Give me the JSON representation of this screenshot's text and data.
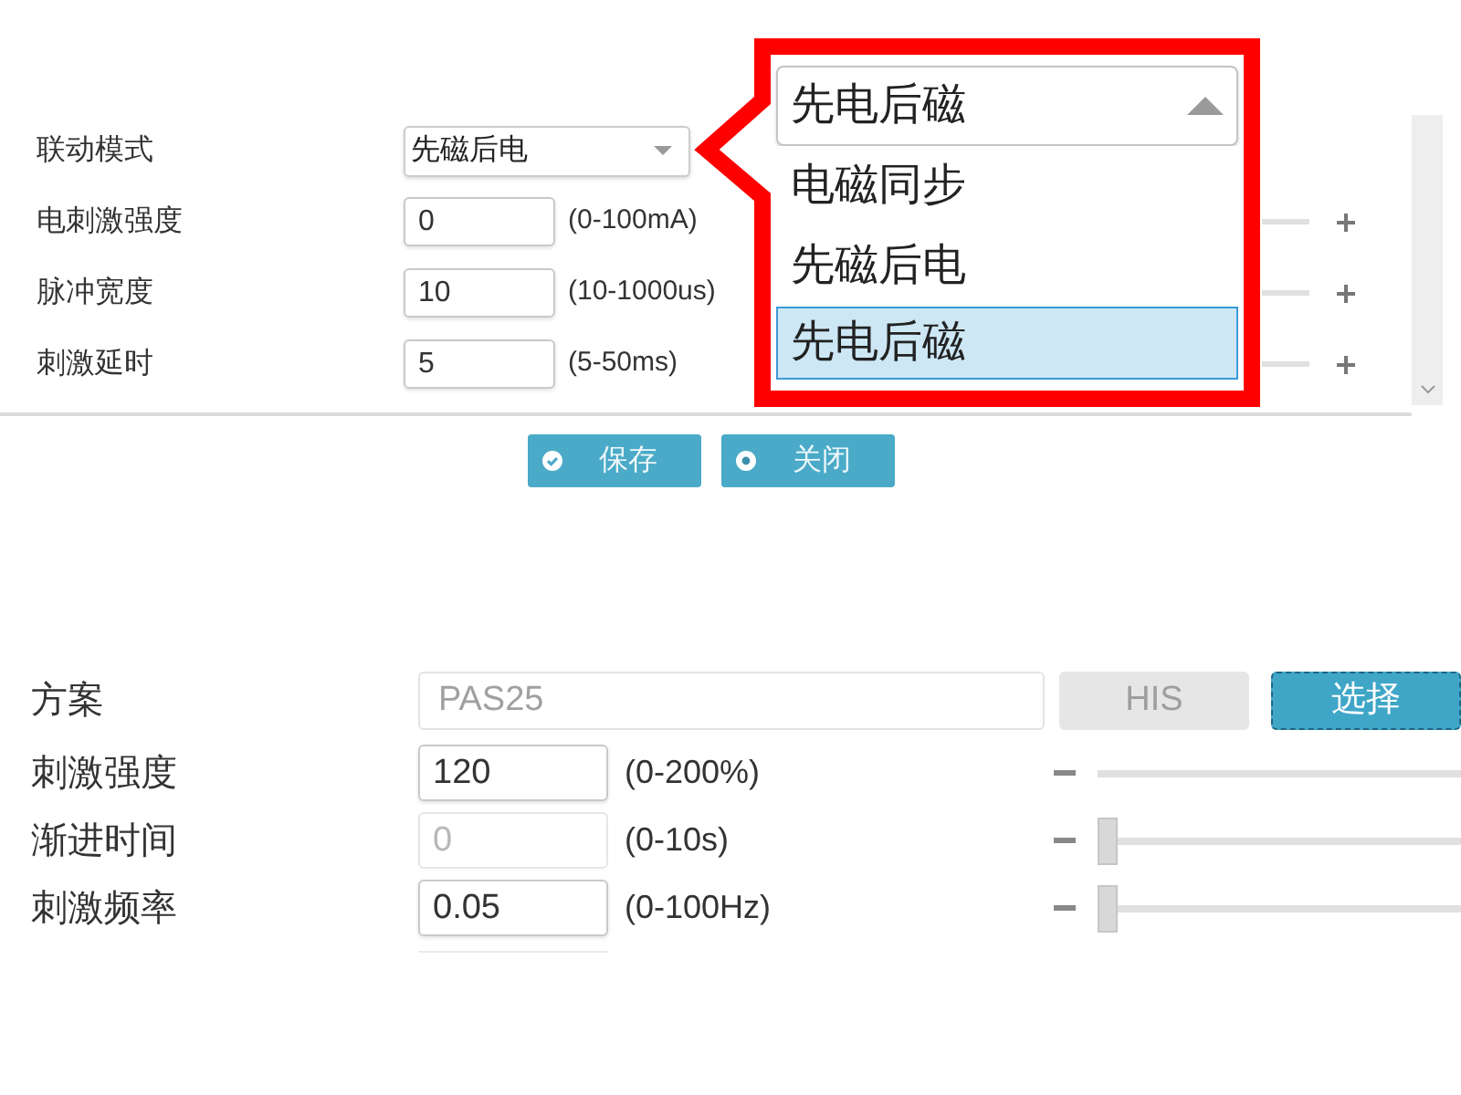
{
  "link_mode": {
    "label": "联动模式",
    "value": "先磁后电"
  },
  "stim_rows": [
    {
      "label": "电刺激强度",
      "value": "0",
      "range": "(0-100mA)"
    },
    {
      "label": "脉冲宽度",
      "value": "10",
      "range": "(10-1000us)"
    },
    {
      "label": "刺激延时",
      "value": "5",
      "range": "(5-50ms)"
    }
  ],
  "buttons": [
    {
      "label": "保存",
      "kind": "save"
    },
    {
      "label": "关闭",
      "kind": "close"
    }
  ],
  "zoom_callout": {
    "value": "先电后磁",
    "expanded": true,
    "options": [
      {
        "label": "电磁同步",
        "selected": false
      },
      {
        "label": "先磁后电",
        "selected": false
      },
      {
        "label": "先电后磁",
        "selected": true
      }
    ]
  },
  "scheme": {
    "label": "方案",
    "value": "PAS25",
    "disabled": true
  },
  "scheme_buttons": [
    {
      "label": "HIS",
      "disabled": true,
      "focused": false
    },
    {
      "label": "选择",
      "disabled": false,
      "focused": true
    }
  ],
  "params": [
    {
      "label": "刺激强度",
      "value": "120",
      "range": "(0-200%)",
      "disabled": false
    },
    {
      "label": "渐进时间",
      "value": "0",
      "range": "(0-10s)",
      "disabled": true,
      "level": 0
    },
    {
      "label": "刺激频率",
      "value": "0.05",
      "range": "(0-100Hz)",
      "disabled": false,
      "level": 0
    }
  ]
}
